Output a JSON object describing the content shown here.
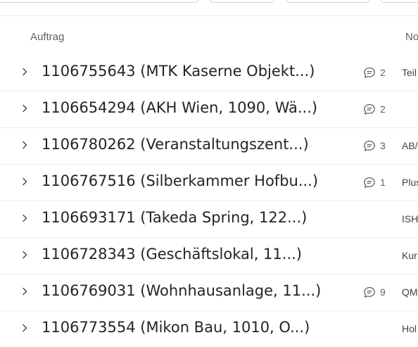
{
  "header": {
    "col_auftrag": "Auftrag",
    "col_notiz": "No"
  },
  "rows": [
    {
      "order": "1106755643 (MTK Kaserne Objekt...)",
      "comments": "2",
      "note": "Teil"
    },
    {
      "order": "1106654294 (AKH Wien, 1090, Wä...)",
      "comments": "2",
      "note": ""
    },
    {
      "order": "1106780262 (Veranstaltungszent...)",
      "comments": "3",
      "note": "AB/"
    },
    {
      "order": "1106767516 (Silberkammer Hofbu...)",
      "comments": "1",
      "note": "Plus"
    },
    {
      "order": "1106693171 (Takeda Spring, 122...)",
      "comments": null,
      "note": "ISH"
    },
    {
      "order": "1106728343 (Geschäftslokal, 11...)",
      "comments": null,
      "note": "Kur"
    },
    {
      "order": "1106769031 (Wohnhausanlage, 11...)",
      "comments": "9",
      "note": "QM"
    },
    {
      "order": "1106773554 (Mikon Bau, 1010, O...)",
      "comments": null,
      "note": "Hol"
    }
  ],
  "icons": {
    "expand": "chevron-right-icon",
    "comment": "comment-icon"
  }
}
